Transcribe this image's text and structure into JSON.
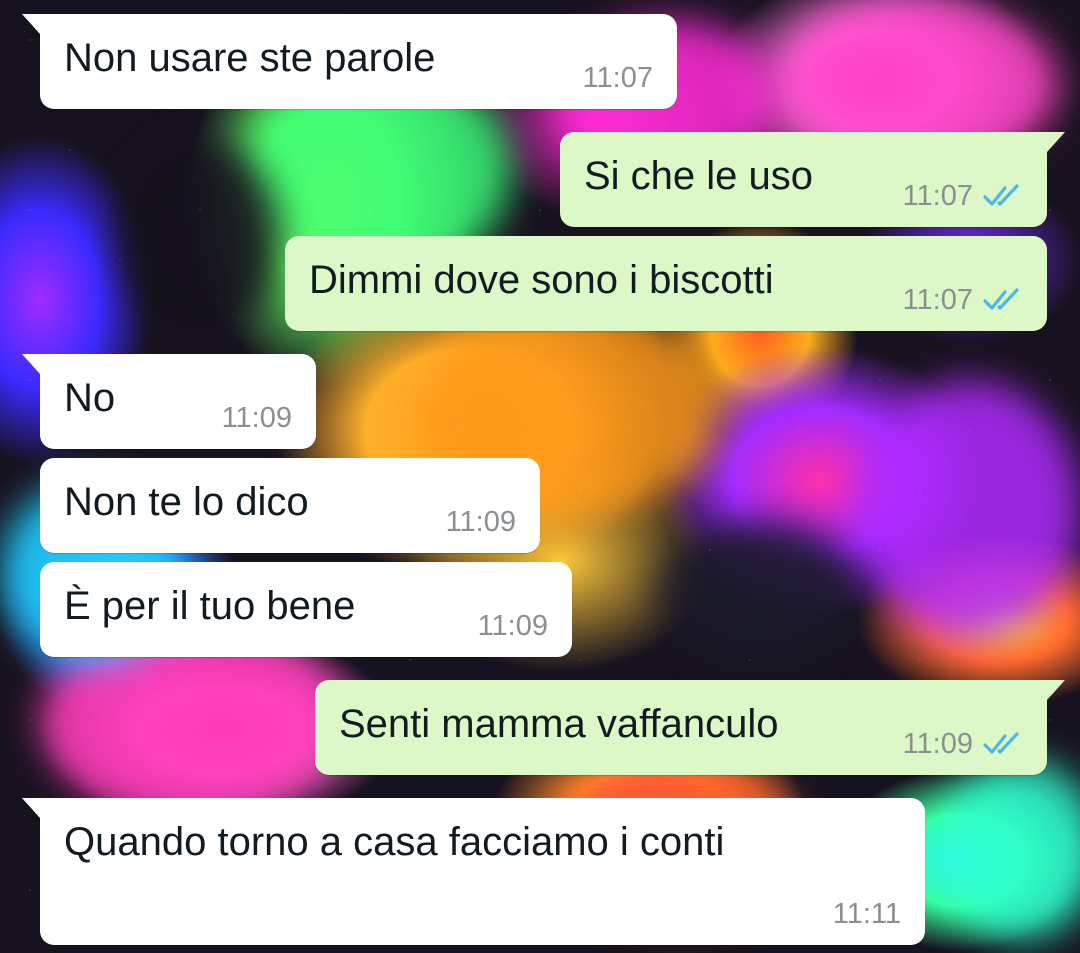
{
  "theme": {
    "incoming_bubble_color": "#ffffff",
    "outgoing_bubble_color": "#dcf8c6",
    "read_ticks_color": "#4fb6ec",
    "time_color": "#8a8f93"
  },
  "messages": [
    {
      "direction": "incoming",
      "text": "Non usare ste parole",
      "time": "11:07"
    },
    {
      "direction": "outgoing",
      "text": "Si che le uso",
      "time": "11:07",
      "status": "read-double-check-icon"
    },
    {
      "direction": "outgoing",
      "text": "Dimmi dove sono i biscotti",
      "time": "11:07",
      "status": "read-double-check-icon"
    },
    {
      "direction": "incoming",
      "text": "No",
      "time": "11:09"
    },
    {
      "direction": "incoming",
      "text": "Non te lo dico",
      "time": "11:09"
    },
    {
      "direction": "incoming",
      "text": "È per il tuo bene",
      "time": "11:09"
    },
    {
      "direction": "outgoing",
      "text": "Senti mamma vaffanculo",
      "time": "11:09",
      "status": "read-double-check-icon"
    },
    {
      "direction": "incoming",
      "text": "Quando torno a casa facciamo i conti",
      "time": "11:11"
    }
  ]
}
